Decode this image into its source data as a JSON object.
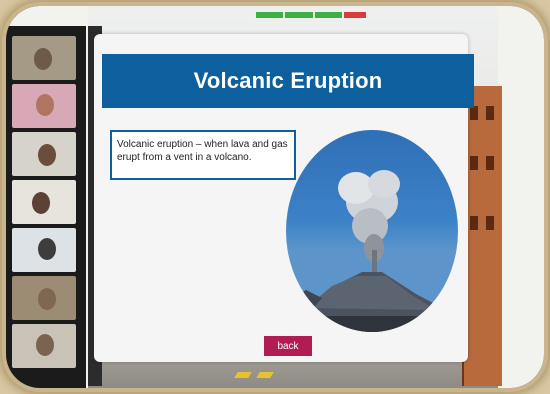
{
  "slide": {
    "title": "Volcanic Eruption",
    "definition": "Volcanic eruption – when lava and gas erupt from a vent in a volcano.",
    "back_label": "back",
    "image_subject": "volcano-eruption-photo"
  },
  "colors": {
    "banner": "#0d5f9d",
    "back_button": "#b01d55",
    "defbox_border": "#0d5f9d"
  },
  "participants": [
    {
      "id": "p1"
    },
    {
      "id": "p2"
    },
    {
      "id": "p3"
    },
    {
      "id": "p4"
    },
    {
      "id": "p5"
    },
    {
      "id": "p6"
    },
    {
      "id": "p7"
    }
  ]
}
